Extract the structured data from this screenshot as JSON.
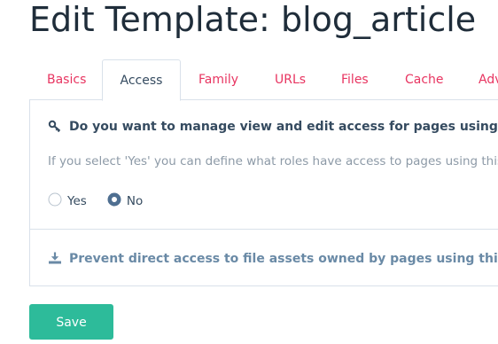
{
  "page": {
    "title": "Edit Template: blog_article"
  },
  "tabs": [
    {
      "label": "Basics",
      "active": false
    },
    {
      "label": "Access",
      "active": true
    },
    {
      "label": "Family",
      "active": false
    },
    {
      "label": "URLs",
      "active": false
    },
    {
      "label": "Files",
      "active": false
    },
    {
      "label": "Cache",
      "active": false
    },
    {
      "label": "Adv",
      "active": false
    }
  ],
  "access": {
    "question": "Do you want to manage view and edit access for pages using this template?",
    "help": "If you select 'Yes' you can define what roles have access to pages using this template.",
    "options": [
      {
        "label": "Yes",
        "checked": false
      },
      {
        "label": "No",
        "checked": true
      }
    ],
    "file_assets_heading": "Prevent direct access to file assets owned by pages using this template?"
  },
  "buttons": {
    "save_label": "Save"
  },
  "colors": {
    "accent": "#e83561",
    "save": "#2dbb9a",
    "heading": "#354b60",
    "link_heading": "#6a8aa6",
    "help_text": "#8d9aa7",
    "radio_checked": "#4f6f91"
  },
  "icons": {
    "access_question": "key-icon",
    "file_assets": "download-icon"
  }
}
